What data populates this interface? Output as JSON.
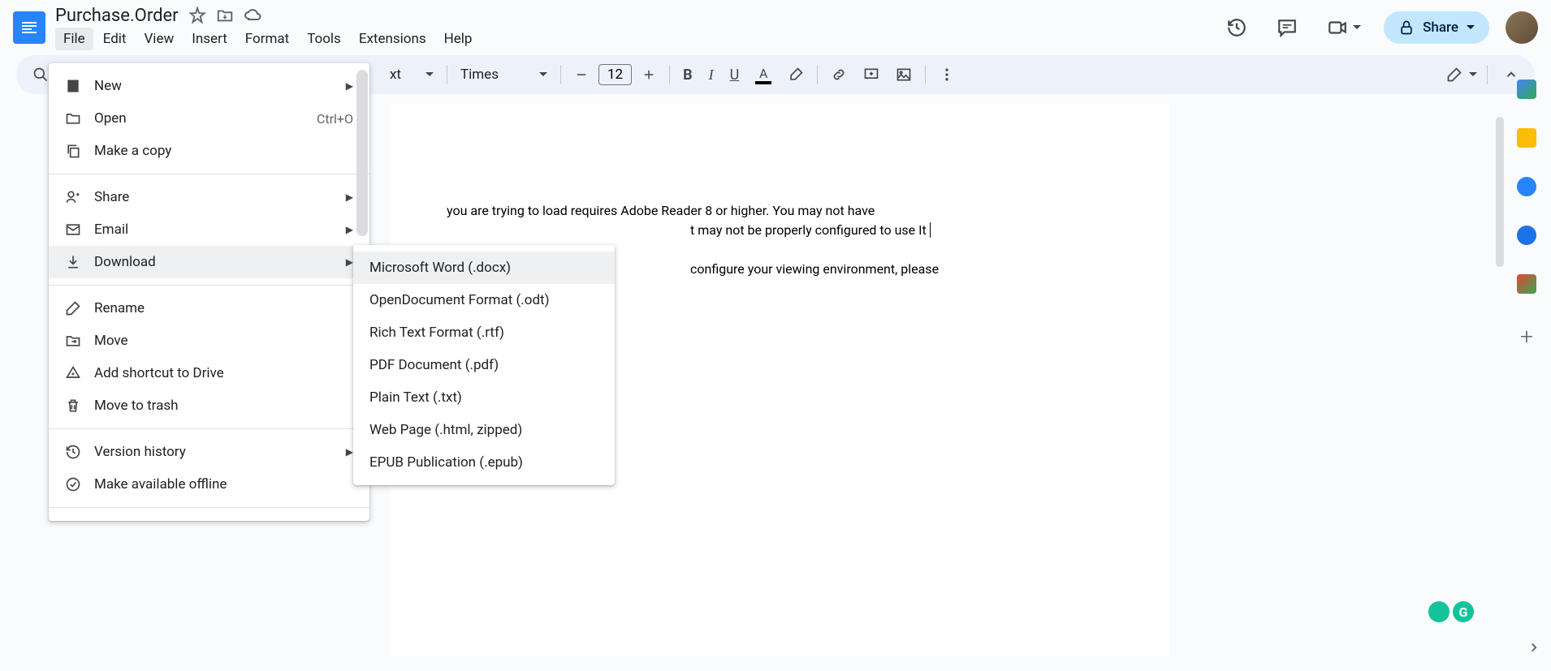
{
  "header": {
    "doc_title": "Purchase.Order",
    "share_label": "Share"
  },
  "menu_bar": {
    "file": "File",
    "edit": "Edit",
    "view": "View",
    "insert": "Insert",
    "format": "Format",
    "tools": "Tools",
    "extensions": "Extensions",
    "help": "Help"
  },
  "toolbar": {
    "style_label": "xt",
    "font_label": "Times",
    "font_size": "12"
  },
  "file_menu": {
    "new": "New",
    "open": "Open",
    "open_shortcut": "Ctrl+O",
    "make_copy": "Make a copy",
    "share": "Share",
    "email": "Email",
    "download": "Download",
    "rename": "Rename",
    "move": "Move",
    "add_shortcut": "Add shortcut to Drive",
    "move_trash": "Move to trash",
    "version_history": "Version history",
    "make_offline": "Make available offline"
  },
  "download_submenu": {
    "docx": "Microsoft Word (.docx)",
    "odt": "OpenDocument Format (.odt)",
    "rtf": "Rich Text Format (.rtf)",
    "pdf": "PDF Document (.pdf)",
    "txt": "Plain Text (.txt)",
    "html": "Web Page (.html, zipped)",
    "epub": "EPUB Publication (.epub)"
  },
  "document_text": {
    "line1_visible": "you are trying to load requires Adobe Reader 8 or higher. You may not have",
    "line2_visible": "t may not be properly configured to use It",
    "line3_visible": "configure your viewing environment, please"
  }
}
